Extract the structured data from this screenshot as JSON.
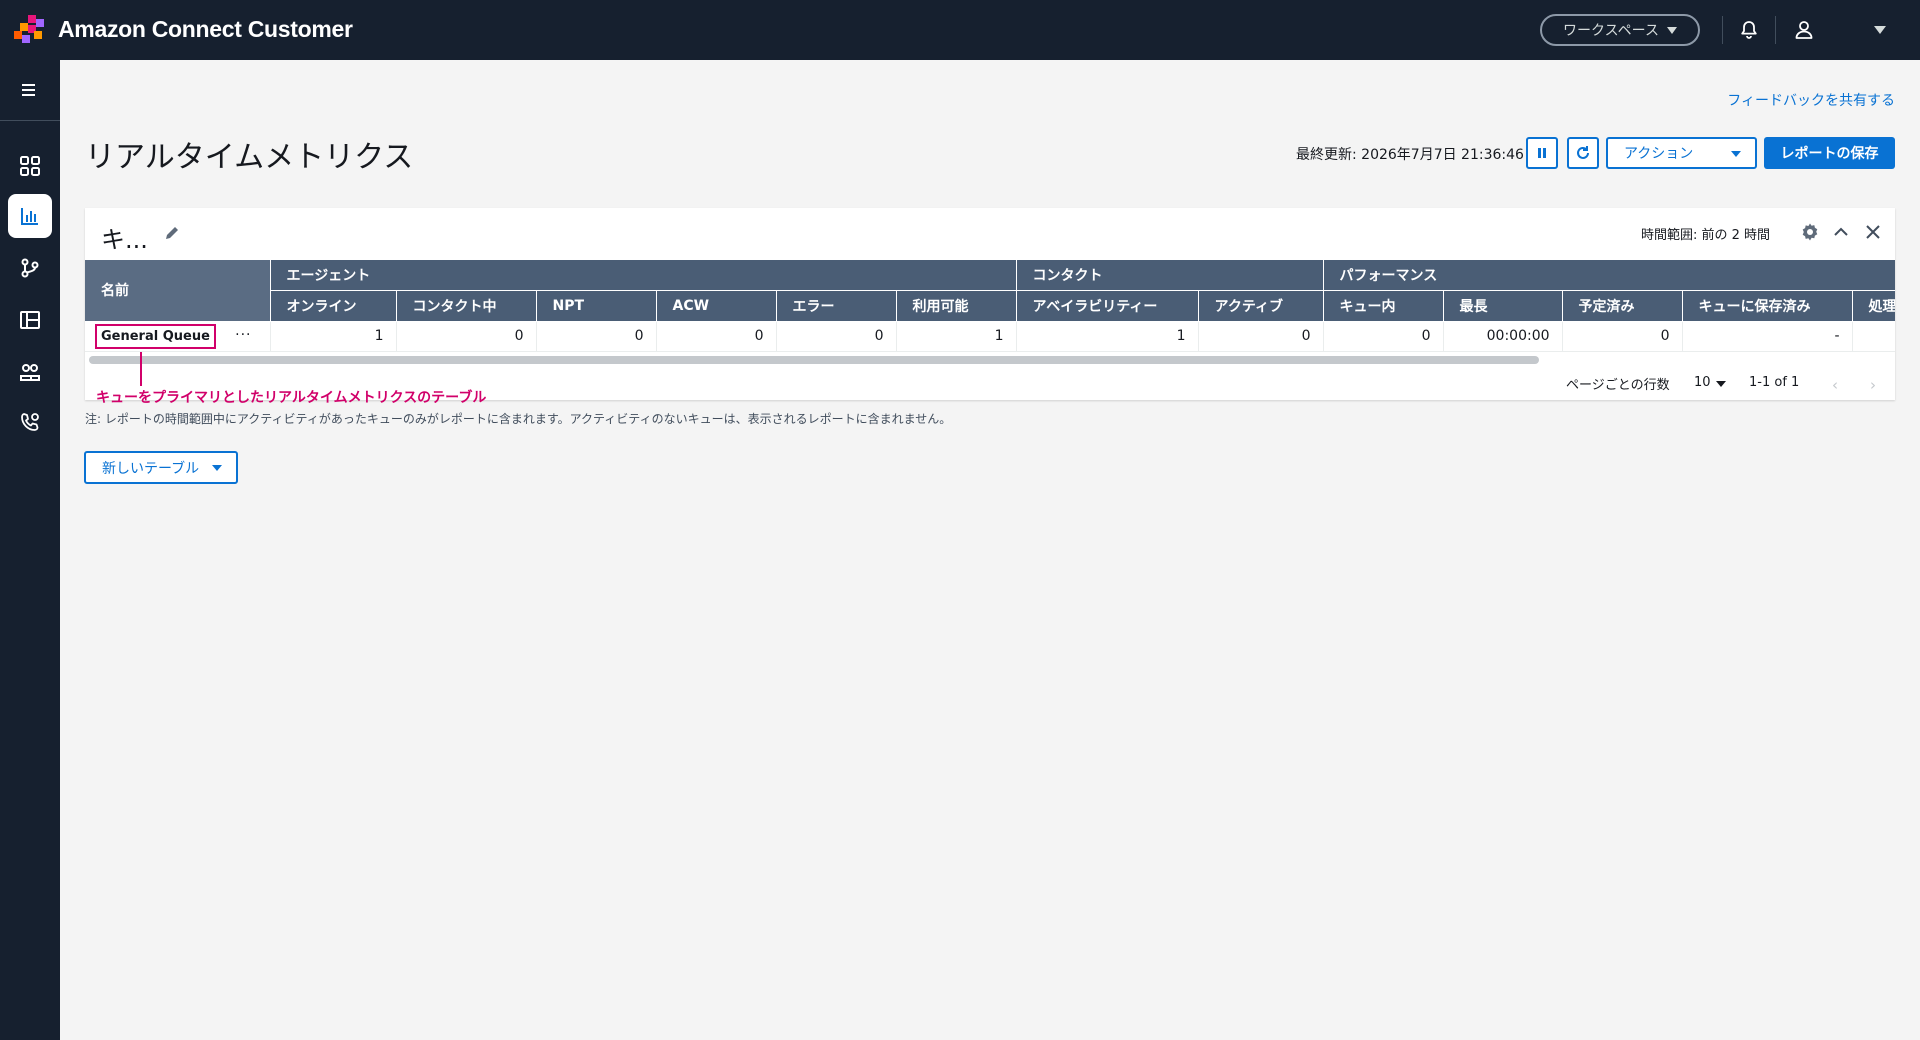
{
  "header": {
    "app_title": "Amazon Connect Customer",
    "workspace_label": "ワークスペース"
  },
  "page": {
    "feedback_link": "フィードバックを共有する",
    "title": "リアルタイムメトリクス",
    "last_updated": "最終更新: 2026年7月7日 21:36:46",
    "action_label": "アクション",
    "save_label": "レポートの保存"
  },
  "card": {
    "title": "キ...",
    "time_range": "時間範囲: 前の 2 時間",
    "name_header": "名前",
    "groups": [
      "エージェント",
      "コンタクト",
      "パフォーマンス"
    ],
    "columns": [
      "オンライン",
      "コンタクト中",
      "NPT",
      "ACW",
      "エラー",
      "利用可能",
      "アベイラビリティー",
      "アクティブ",
      "キュー内",
      "最長",
      "予定済み",
      "キューに保存済み",
      "処理"
    ],
    "row": {
      "name": "General Queue",
      "more": "···",
      "values": [
        "1",
        "0",
        "0",
        "0",
        "0",
        "1",
        "1",
        "0",
        "0",
        "00:00:00",
        "0",
        "-",
        ""
      ]
    },
    "annotation": "キューをプライマリとしたリアルタイムメトリクスのテーブル",
    "rows_per_page_label": "ページごとの行数",
    "rows_per_page_value": "10",
    "page_count": "1-1 of 1",
    "prev_arrow": "‹",
    "next_arrow": "›"
  },
  "note": "注: レポートの時間範囲中にアクティビティがあったキューのみがレポートに含まれます。アクティビティのないキューは、表示されるレポートに含まれません。",
  "new_table_label": "新しいテーブル",
  "colors": {
    "topbar": "#16202f",
    "accent": "#0972d3",
    "table_header": "#4a5d75",
    "annotation": "#d1006a"
  }
}
